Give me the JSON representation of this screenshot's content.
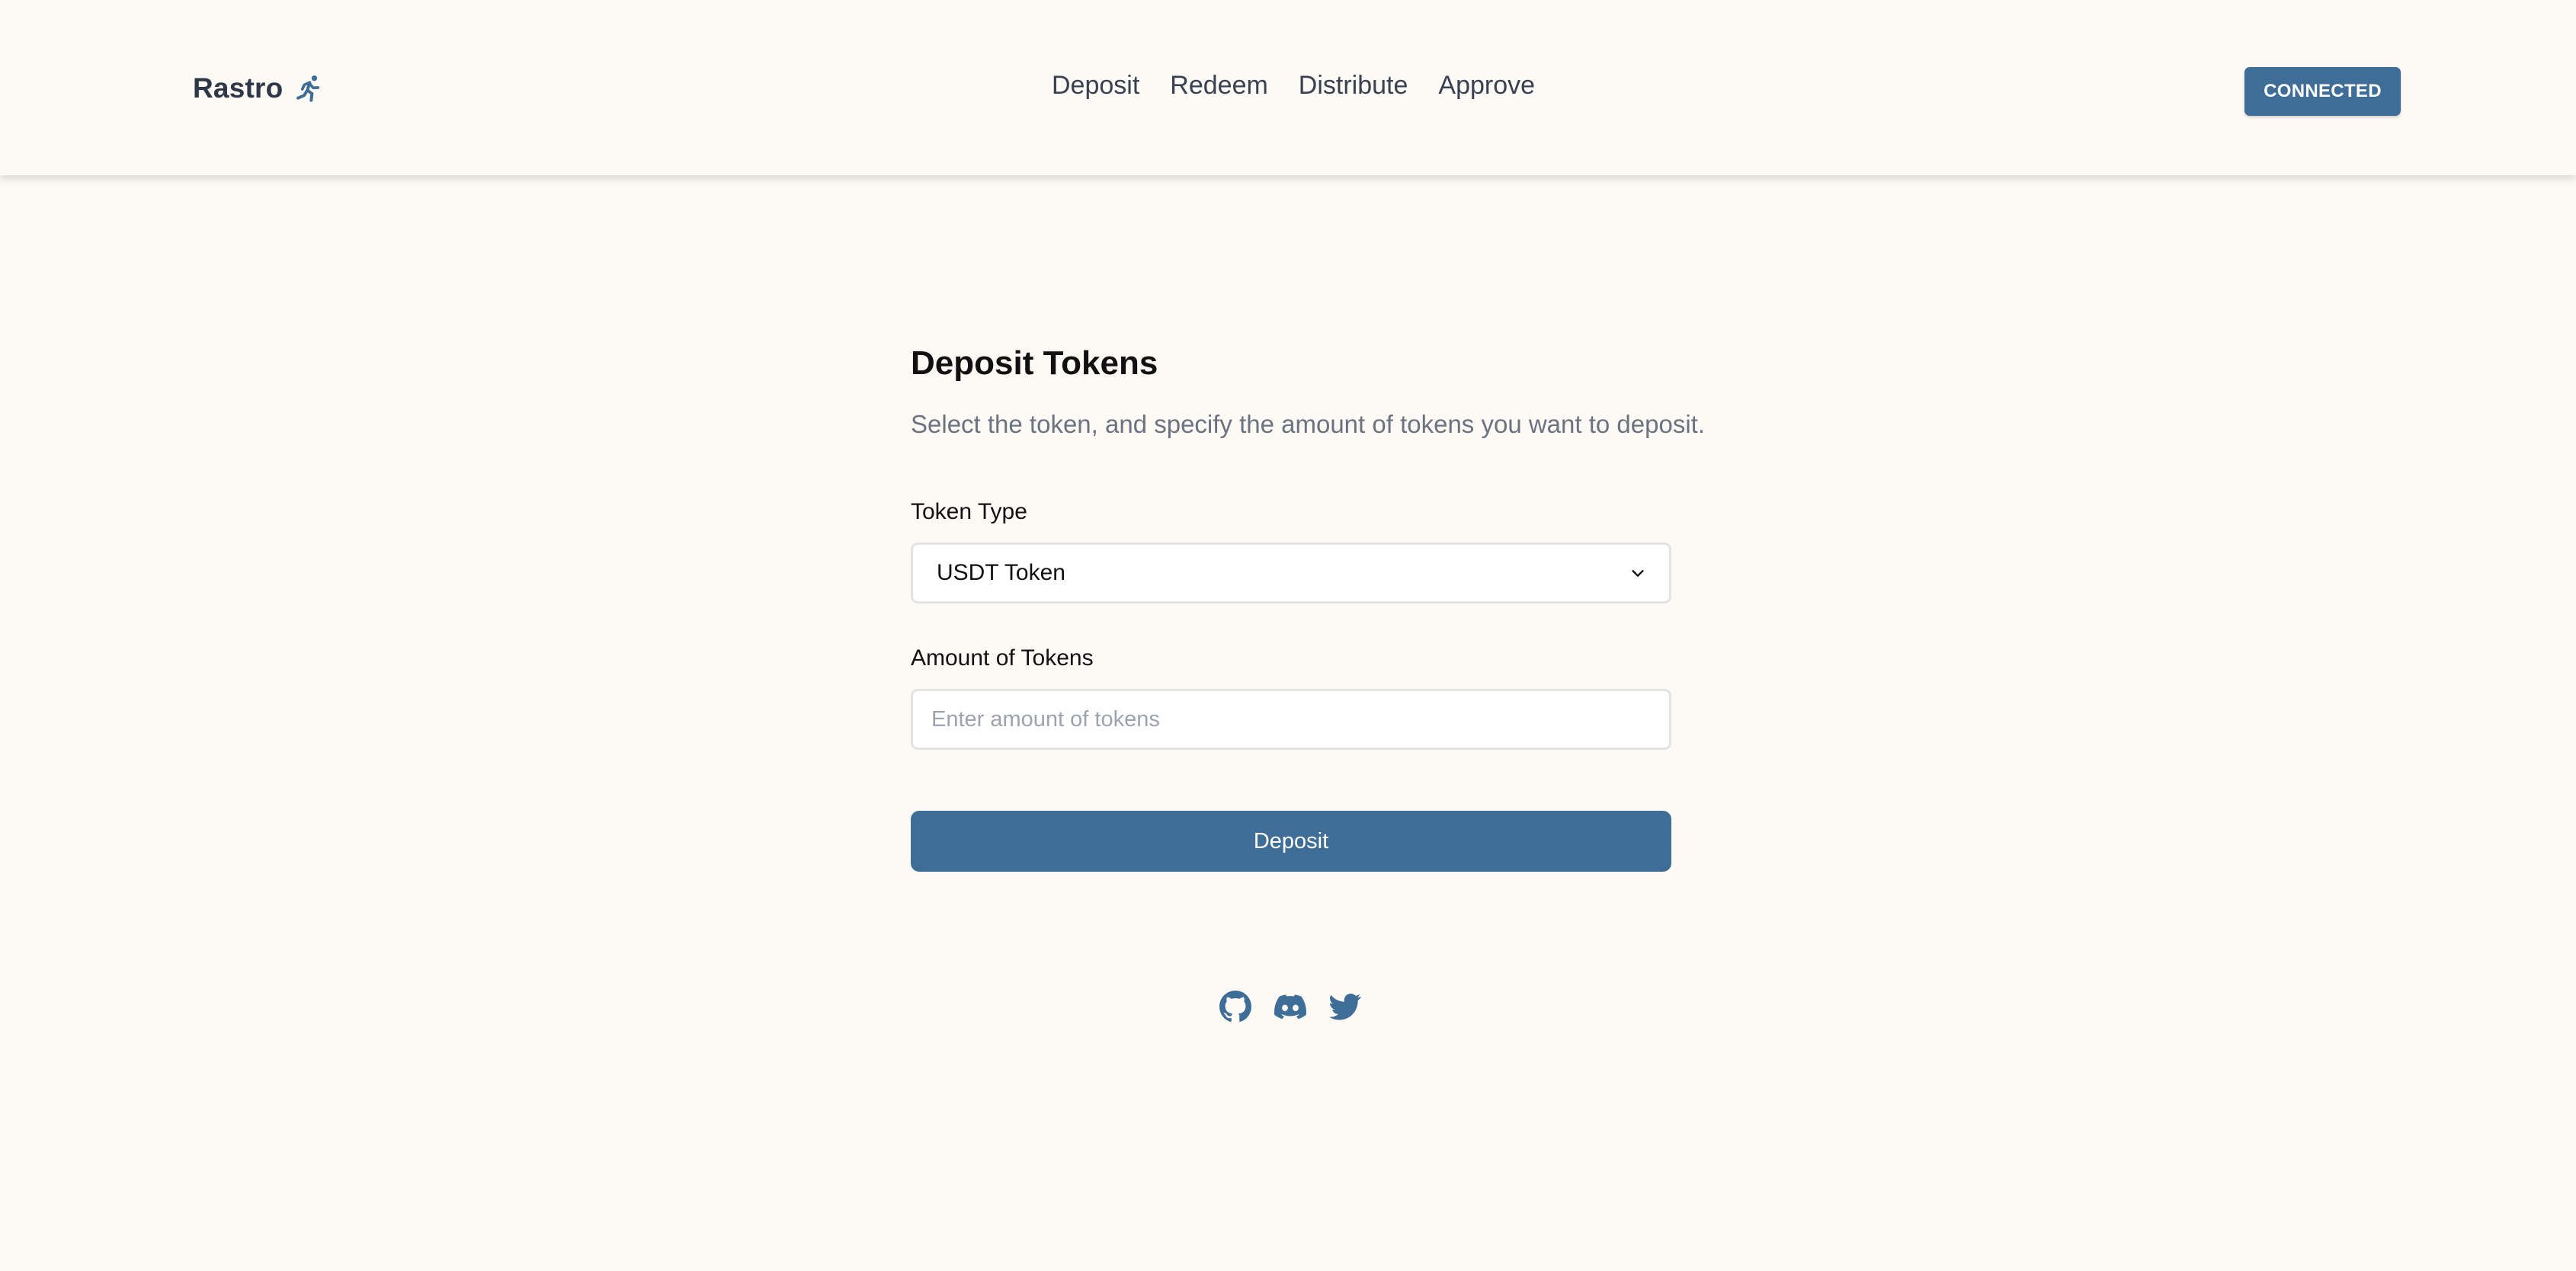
{
  "header": {
    "brand": "Rastro",
    "brand_icon": "running-person-icon",
    "nav": [
      "Deposit",
      "Redeem",
      "Distribute",
      "Approve"
    ],
    "connect_label": "CONNECTED"
  },
  "form": {
    "title": "Deposit Tokens",
    "subtitle": "Select the token, and specify the amount of tokens you want to deposit.",
    "token_label": "Token Type",
    "token_value": "USDT Token",
    "amount_label": "Amount of Tokens",
    "amount_value": "",
    "amount_placeholder": "Enter amount of tokens",
    "submit_label": "Deposit"
  },
  "footer": {
    "social_icons": [
      "github-icon",
      "discord-icon",
      "twitter-icon"
    ]
  },
  "colors": {
    "accent": "#3e6e97",
    "background": "#fdf9f5",
    "text_muted": "#6b7280"
  }
}
